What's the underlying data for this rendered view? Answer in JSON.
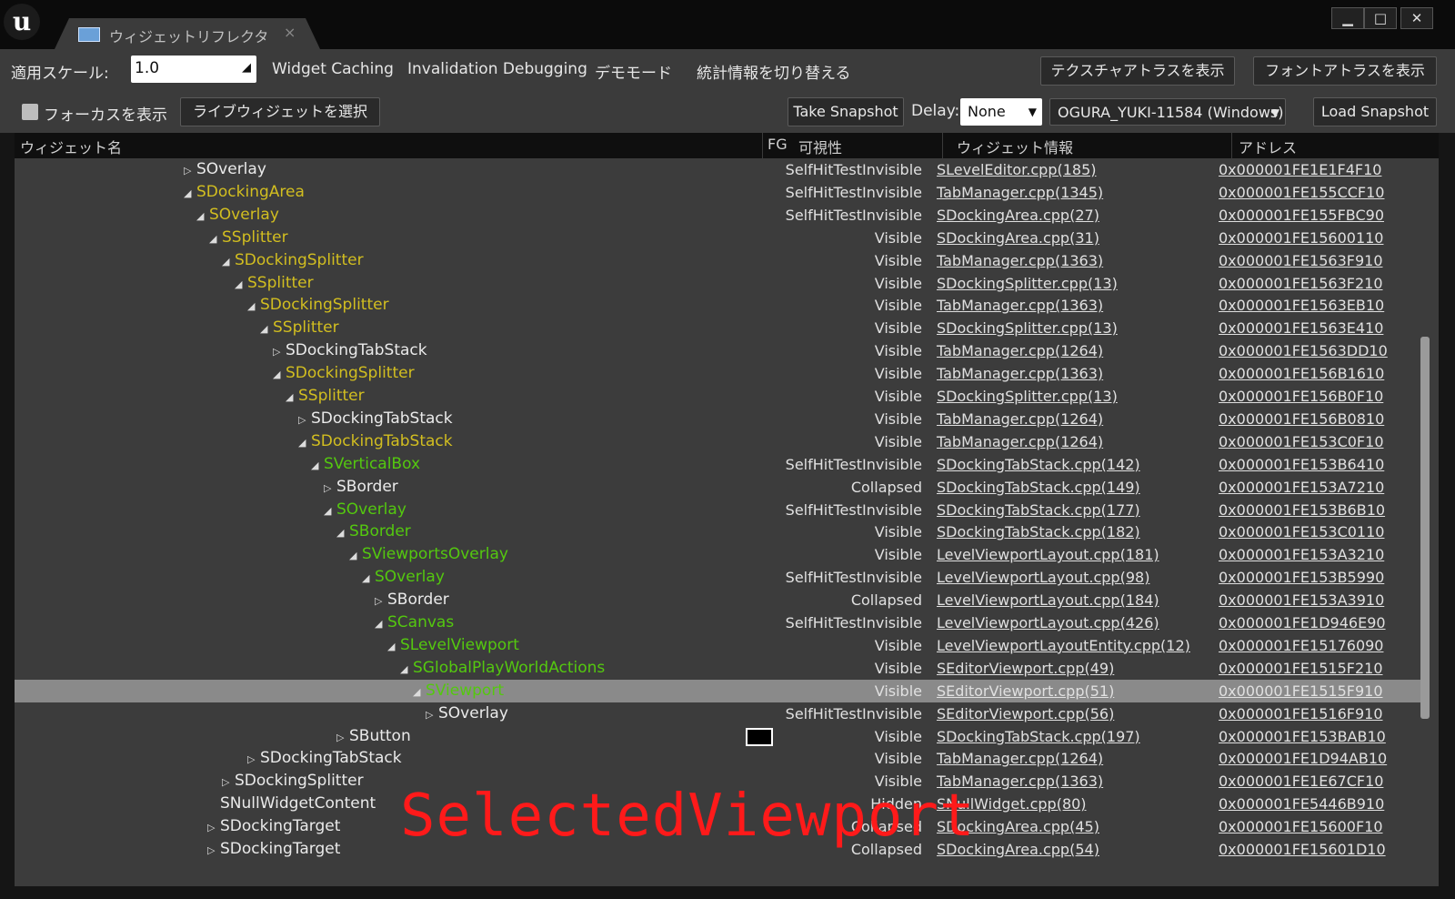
{
  "window": {
    "tab_title": "ウィジェットリフレクタ",
    "tab_close": "×",
    "logo": "u",
    "controls": {
      "minimize": "▁",
      "maximize": "□",
      "close": "✕"
    }
  },
  "toolbar1": {
    "scale_label": "適用スケール:",
    "scale_value": "1.0",
    "widget_caching": "Widget Caching",
    "invalidation_debugging": "Invalidation Debugging",
    "demo_mode": "デモモード",
    "toggle_stats": "統計情報を切り替える",
    "show_texture_atlas": "テクスチャアトラスを表示",
    "show_font_atlas": "フォントアトラスを表示"
  },
  "toolbar2": {
    "show_focus": "フォーカスを表示",
    "select_live_widget": "ライブウィジェットを選択",
    "take_snapshot": "Take Snapshot",
    "delay_label": "Delay:",
    "delay_value": "None",
    "target_value": "OGURA_YUKI-11584 (Windows)",
    "load_snapshot": "Load Snapshot"
  },
  "columns": {
    "widget_name": "ウィジェット名",
    "fg": "FG",
    "visibility": "可視性",
    "widget_info": "ウィジェット情報",
    "address": "アドレス"
  },
  "rows": [
    {
      "name": "SOverlay",
      "vis": "SelfHitTestInvisible",
      "src": "SLevelEditor.cpp(185)",
      "addr": "0x000001FE1E1F4F10"
    },
    {
      "name": "SDockingArea",
      "vis": "SelfHitTestInvisible",
      "src": "TabManager.cpp(1345)",
      "addr": "0x000001FE155CCF10"
    },
    {
      "name": "SOverlay",
      "vis": "SelfHitTestInvisible",
      "src": "SDockingArea.cpp(27)",
      "addr": "0x000001FE155FBC90"
    },
    {
      "name": "SSplitter",
      "vis": "Visible",
      "src": "SDockingArea.cpp(31)",
      "addr": "0x000001FE15600110"
    },
    {
      "name": "SDockingSplitter",
      "vis": "Visible",
      "src": "TabManager.cpp(1363)",
      "addr": "0x000001FE1563F910"
    },
    {
      "name": "SSplitter",
      "vis": "Visible",
      "src": "SDockingSplitter.cpp(13)",
      "addr": "0x000001FE1563F210"
    },
    {
      "name": "SDockingSplitter",
      "vis": "Visible",
      "src": "TabManager.cpp(1363)",
      "addr": "0x000001FE1563EB10"
    },
    {
      "name": "SSplitter",
      "vis": "Visible",
      "src": "SDockingSplitter.cpp(13)",
      "addr": "0x000001FE1563E410"
    },
    {
      "name": "SDockingTabStack",
      "vis": "Visible",
      "src": "TabManager.cpp(1264)",
      "addr": "0x000001FE1563DD10"
    },
    {
      "name": "SDockingSplitter",
      "vis": "Visible",
      "src": "TabManager.cpp(1363)",
      "addr": "0x000001FE156B1610"
    },
    {
      "name": "SSplitter",
      "vis": "Visible",
      "src": "SDockingSplitter.cpp(13)",
      "addr": "0x000001FE156B0F10"
    },
    {
      "name": "SDockingTabStack",
      "vis": "Visible",
      "src": "TabManager.cpp(1264)",
      "addr": "0x000001FE156B0810"
    },
    {
      "name": "SDockingTabStack",
      "vis": "Visible",
      "src": "TabManager.cpp(1264)",
      "addr": "0x000001FE153C0F10"
    },
    {
      "name": "SVerticalBox",
      "vis": "SelfHitTestInvisible",
      "src": "SDockingTabStack.cpp(142)",
      "addr": "0x000001FE153B6410"
    },
    {
      "name": "SBorder",
      "vis": "Collapsed",
      "src": "SDockingTabStack.cpp(149)",
      "addr": "0x000001FE153A7210"
    },
    {
      "name": "SOverlay",
      "vis": "SelfHitTestInvisible",
      "src": "SDockingTabStack.cpp(177)",
      "addr": "0x000001FE153B6B10"
    },
    {
      "name": "SBorder",
      "vis": "Visible",
      "src": "SDockingTabStack.cpp(182)",
      "addr": "0x000001FE153C0110"
    },
    {
      "name": "SViewportsOverlay",
      "vis": "Visible",
      "src": "LevelViewportLayout.cpp(181)",
      "addr": "0x000001FE153A3210"
    },
    {
      "name": "SOverlay",
      "vis": "SelfHitTestInvisible",
      "src": "LevelViewportLayout.cpp(98)",
      "addr": "0x000001FE153B5990"
    },
    {
      "name": "SBorder",
      "vis": "Collapsed",
      "src": "LevelViewportLayout.cpp(184)",
      "addr": "0x000001FE153A3910"
    },
    {
      "name": "SCanvas",
      "vis": "SelfHitTestInvisible",
      "src": "LevelViewportLayout.cpp(426)",
      "addr": "0x000001FE1D946E90"
    },
    {
      "name": "SLevelViewport",
      "vis": "Visible",
      "src": "LevelViewportLayoutEntity.cpp(12)",
      "addr": "0x000001FE15176090"
    },
    {
      "name": "SGlobalPlayWorldActions",
      "vis": "Visible",
      "src": "SEditorViewport.cpp(49)",
      "addr": "0x000001FE1515F210"
    },
    {
      "name": "SViewport",
      "vis": "Visible",
      "src": "SEditorViewport.cpp(51)",
      "addr": "0x000001FE1515F910"
    },
    {
      "name": "SOverlay",
      "vis": "SelfHitTestInvisible",
      "src": "SEditorViewport.cpp(56)",
      "addr": "0x000001FE1516F910"
    },
    {
      "name": "SButton",
      "vis": "Visible",
      "src": "SDockingTabStack.cpp(197)",
      "addr": "0x000001FE153BAB10"
    },
    {
      "name": "SDockingTabStack",
      "vis": "Visible",
      "src": "TabManager.cpp(1264)",
      "addr": "0x000001FE1D94AB10"
    },
    {
      "name": "SDockingSplitter",
      "vis": "Visible",
      "src": "TabManager.cpp(1363)",
      "addr": "0x000001FE1E67CF10"
    },
    {
      "name": "SNullWidgetContent",
      "vis": "Hidden",
      "src": "SNullWidget.cpp(80)",
      "addr": "0x000001FE5446B910"
    },
    {
      "name": "SDockingTarget",
      "vis": "Collapsed",
      "src": "SDockingArea.cpp(45)",
      "addr": "0x000001FE15600F10"
    },
    {
      "name": "SDockingTarget",
      "vis": "Collapsed",
      "src": "SDockingArea.cpp(54)",
      "addr": "0x000001FE15601D10"
    }
  ],
  "overlay_annotation": "SelectedViewport",
  "colors": {
    "path_highlight": "#d2be20",
    "deep_highlight": "#54c80f",
    "selected_row": "#8a8a8a",
    "annotation": "#ff1a1a"
  }
}
